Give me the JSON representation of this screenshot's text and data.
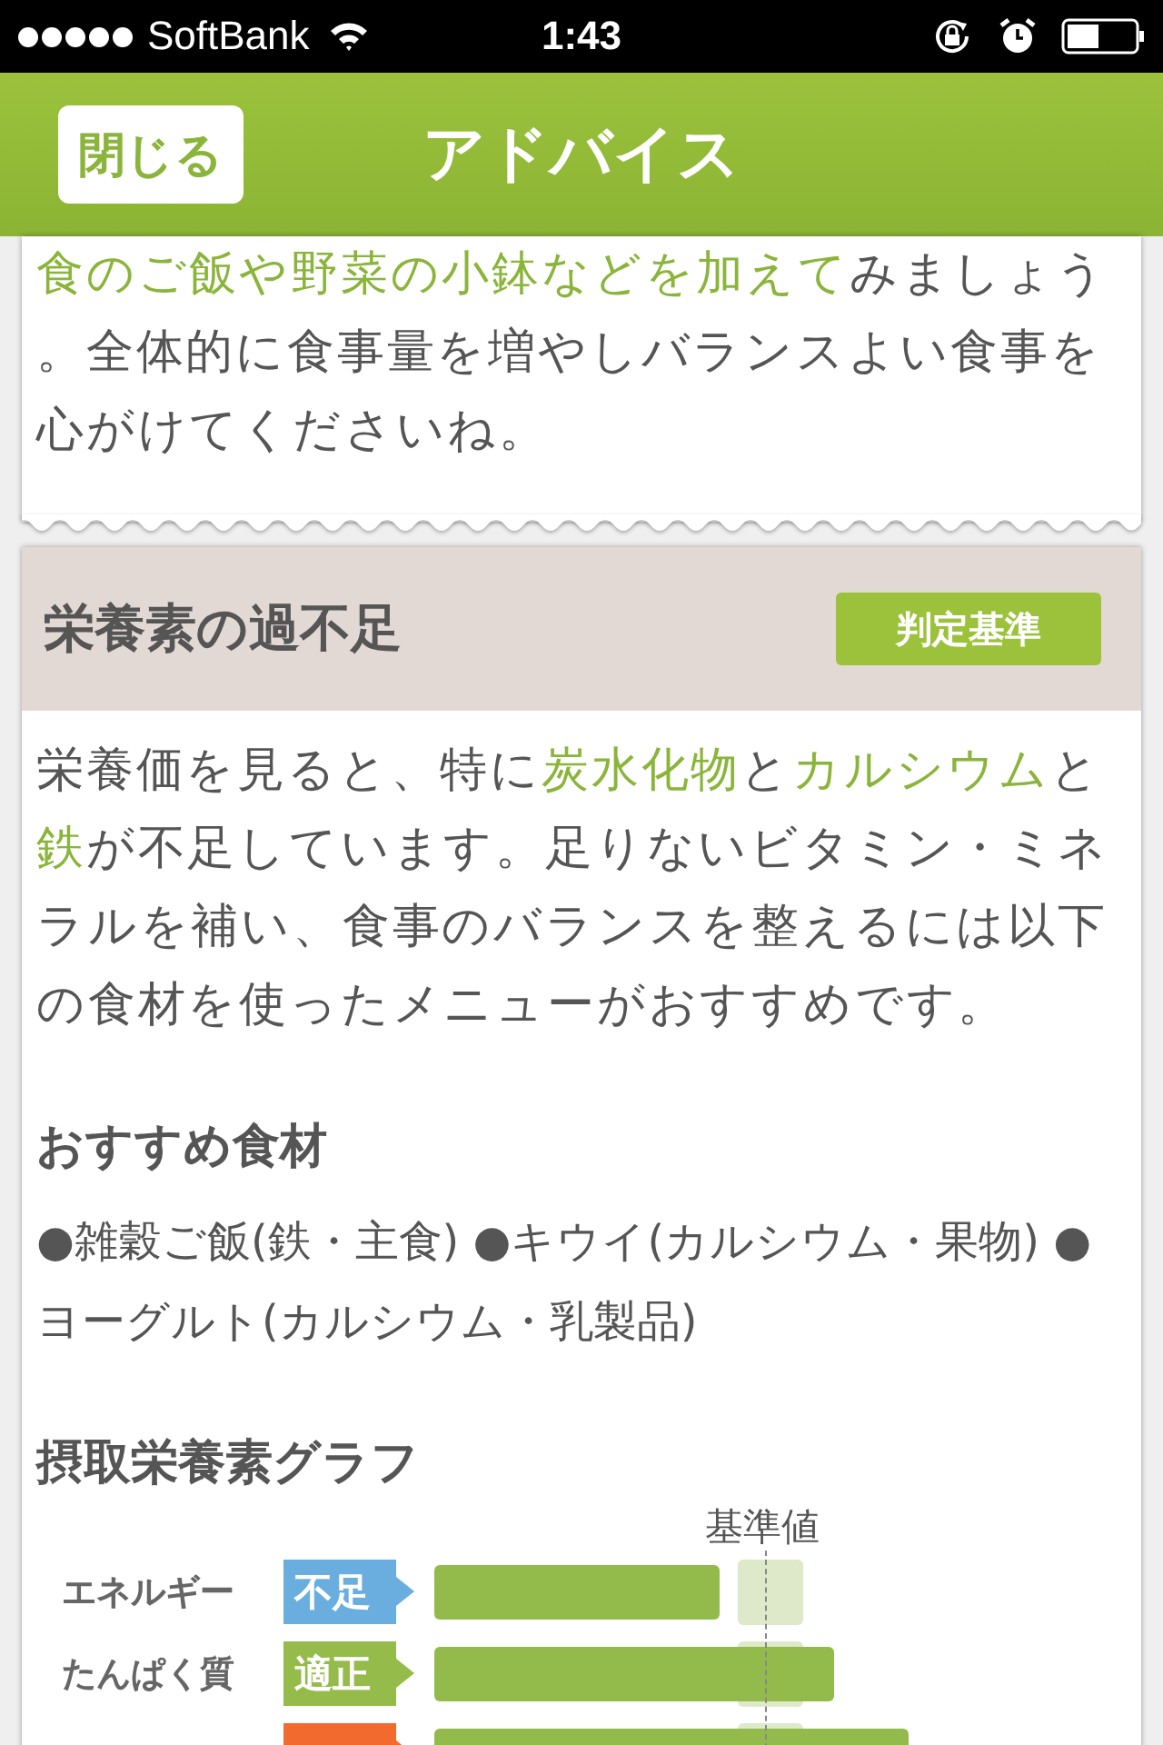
{
  "status_bar": {
    "carrier": "SoftBank",
    "time": "1:43"
  },
  "nav_bar": {
    "close_button": "閉じる",
    "title": "アドバイス"
  },
  "advice_card": {
    "segments": [
      {
        "text": "食のご飯や野菜の小鉢などを加えて",
        "highlight": true
      },
      {
        "text": "みましょう。全体的に食事量を増やしバランスよい食事を心がけてくださいね。",
        "highlight": false
      }
    ]
  },
  "nutrient_card": {
    "title": "栄養素の過不足",
    "criteria_button": "判定基準",
    "segments": [
      {
        "text": "栄養価を見ると、特に",
        "highlight": false
      },
      {
        "text": "炭水化物",
        "highlight": true
      },
      {
        "text": "と",
        "highlight": false
      },
      {
        "text": "カルシウム",
        "highlight": true
      },
      {
        "text": "と",
        "highlight": false
      },
      {
        "text": "鉄",
        "highlight": true
      },
      {
        "text": "が不足しています。足りないビタミン・ミネラルを補い、食事のバランスを整えるには以下の食材を使ったメニューがおすすめです。",
        "highlight": false
      }
    ],
    "foods_heading": "おすすめ食材",
    "foods": "●雑穀ご飯(鉄・主食) ●キウイ(カルシウム・果物) ●ヨーグルト(カルシウム・乳製品)",
    "graph_heading": "摂取栄養素グラフ",
    "graph": {
      "reference_label": "基準値",
      "rows": [
        {
          "nutrient": "エネルギー",
          "status": "不足",
          "color": "#6aaee0",
          "level": 0.42
        },
        {
          "nutrient": "たんぱく質",
          "status": "適正",
          "color": "#95bb4a",
          "level": 0.59
        },
        {
          "color": "#f26a2e",
          "level": 0.7
        }
      ]
    }
  }
}
